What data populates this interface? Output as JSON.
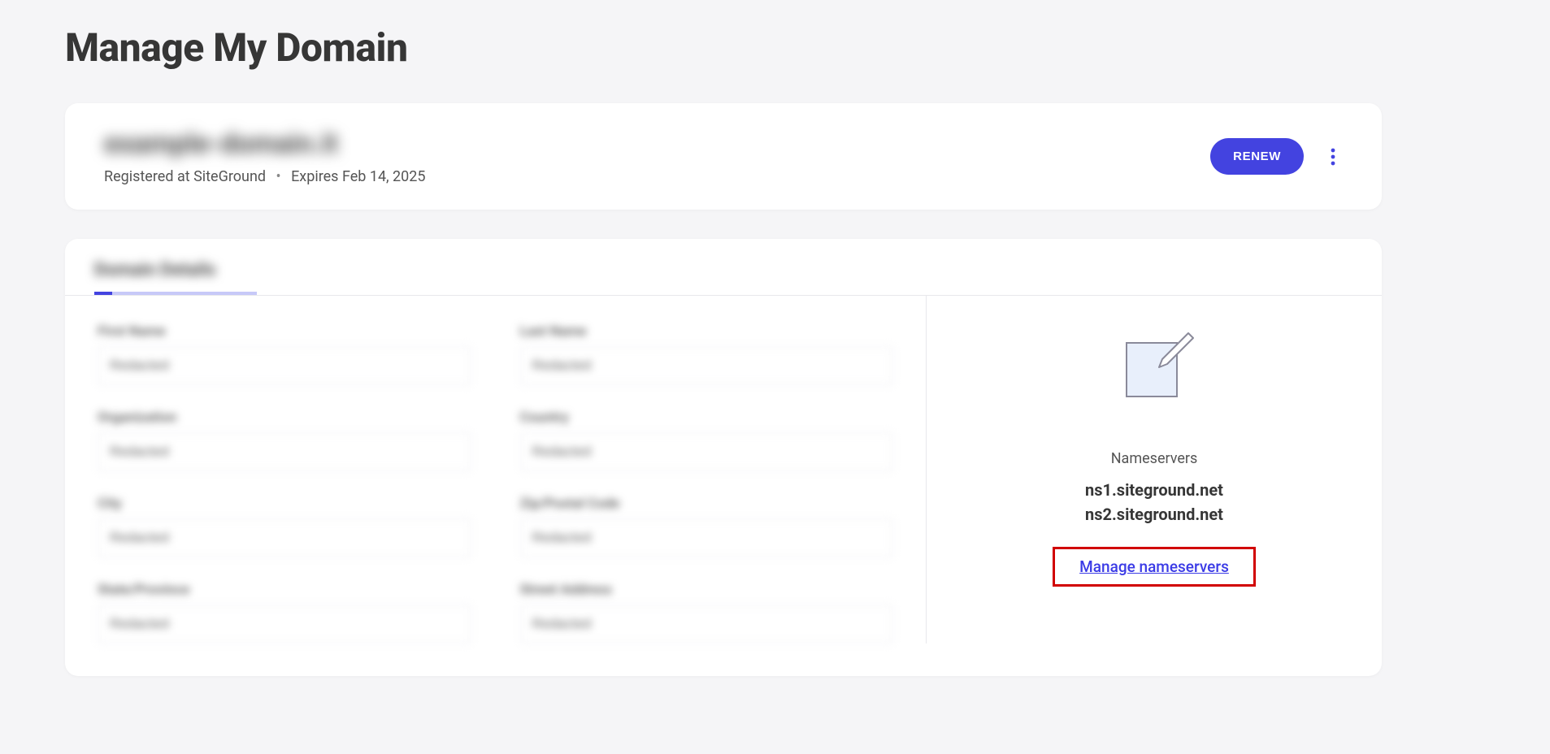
{
  "page": {
    "title": "Manage My Domain"
  },
  "domain": {
    "name_obscured": "example-domain.it",
    "registrar": "Registered at SiteGround",
    "expires": "Expires Feb 14, 2025",
    "renew_label": "RENEW"
  },
  "details": {
    "tab_obscured": "Domain Details",
    "fields": [
      {
        "label": "First Name",
        "value": "Redacted"
      },
      {
        "label": "Last Name",
        "value": "Redacted"
      },
      {
        "label": "Organization",
        "value": "Redacted"
      },
      {
        "label": "Country",
        "value": "Redacted"
      },
      {
        "label": "City",
        "value": "Redacted"
      },
      {
        "label": "Zip/Postal Code",
        "value": "Redacted"
      },
      {
        "label": "State/Province",
        "value": "Redacted"
      },
      {
        "label": "Street Address",
        "value": "Redacted"
      }
    ]
  },
  "nameservers": {
    "title": "Nameservers",
    "values": [
      "ns1.siteground.net",
      "ns2.siteground.net"
    ],
    "manage_label": "Manage nameservers"
  }
}
